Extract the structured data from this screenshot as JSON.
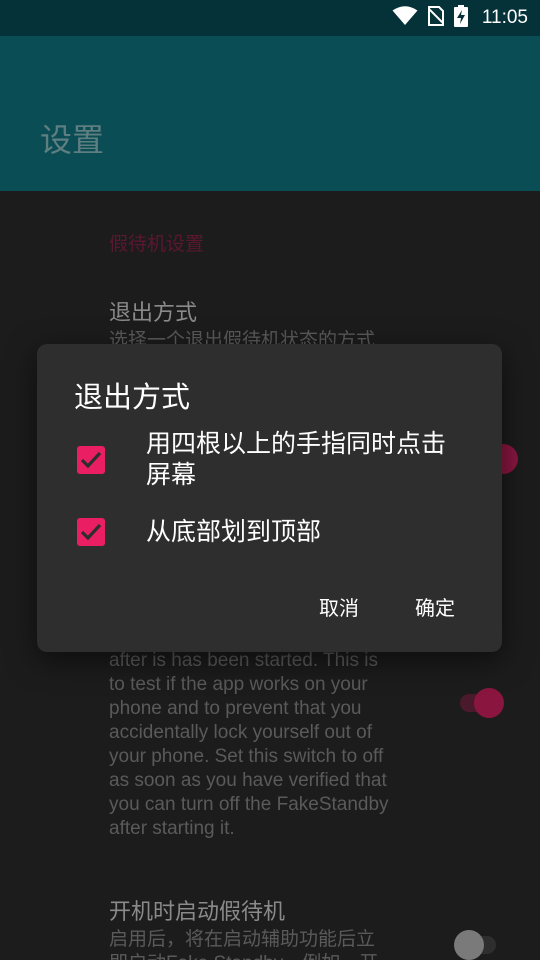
{
  "status_bar": {
    "time": "11:05",
    "icons": [
      "wifi-icon",
      "no-sim-icon",
      "battery-charging-icon"
    ]
  },
  "app_bar": {
    "title": "设置"
  },
  "settings": {
    "section_header": "假待机设置",
    "exit_method": {
      "title": "退出方式",
      "summary": "选择一个退出假待机状态的方式"
    },
    "test_mode": {
      "summary_lines": [
        "after is has been started. This is",
        "to test if the app works on your",
        "phone and to prevent that you",
        "accidentally lock yourself out of",
        "your phone. Set this switch to off",
        "as soon as you have verified that",
        "you can turn off the FakeStandby",
        "after starting it."
      ]
    },
    "start_on_boot": {
      "title": "开机时启动假待机",
      "summary_lines": [
        "启用后，将在启动辅助功能后立",
        "即启动Fake Standby。例如，开"
      ]
    }
  },
  "dialog": {
    "title": "退出方式",
    "options": [
      {
        "label": "用四根以上的手指同时点击屏幕",
        "checked": true
      },
      {
        "label": "从底部划到顶部",
        "checked": true
      }
    ],
    "cancel_label": "取消",
    "ok_label": "确定"
  },
  "colors": {
    "accent": "#e91e63",
    "app_bar": "#0b4d54",
    "status_bar": "#053238",
    "dialog_bg": "#2e2e2e"
  }
}
